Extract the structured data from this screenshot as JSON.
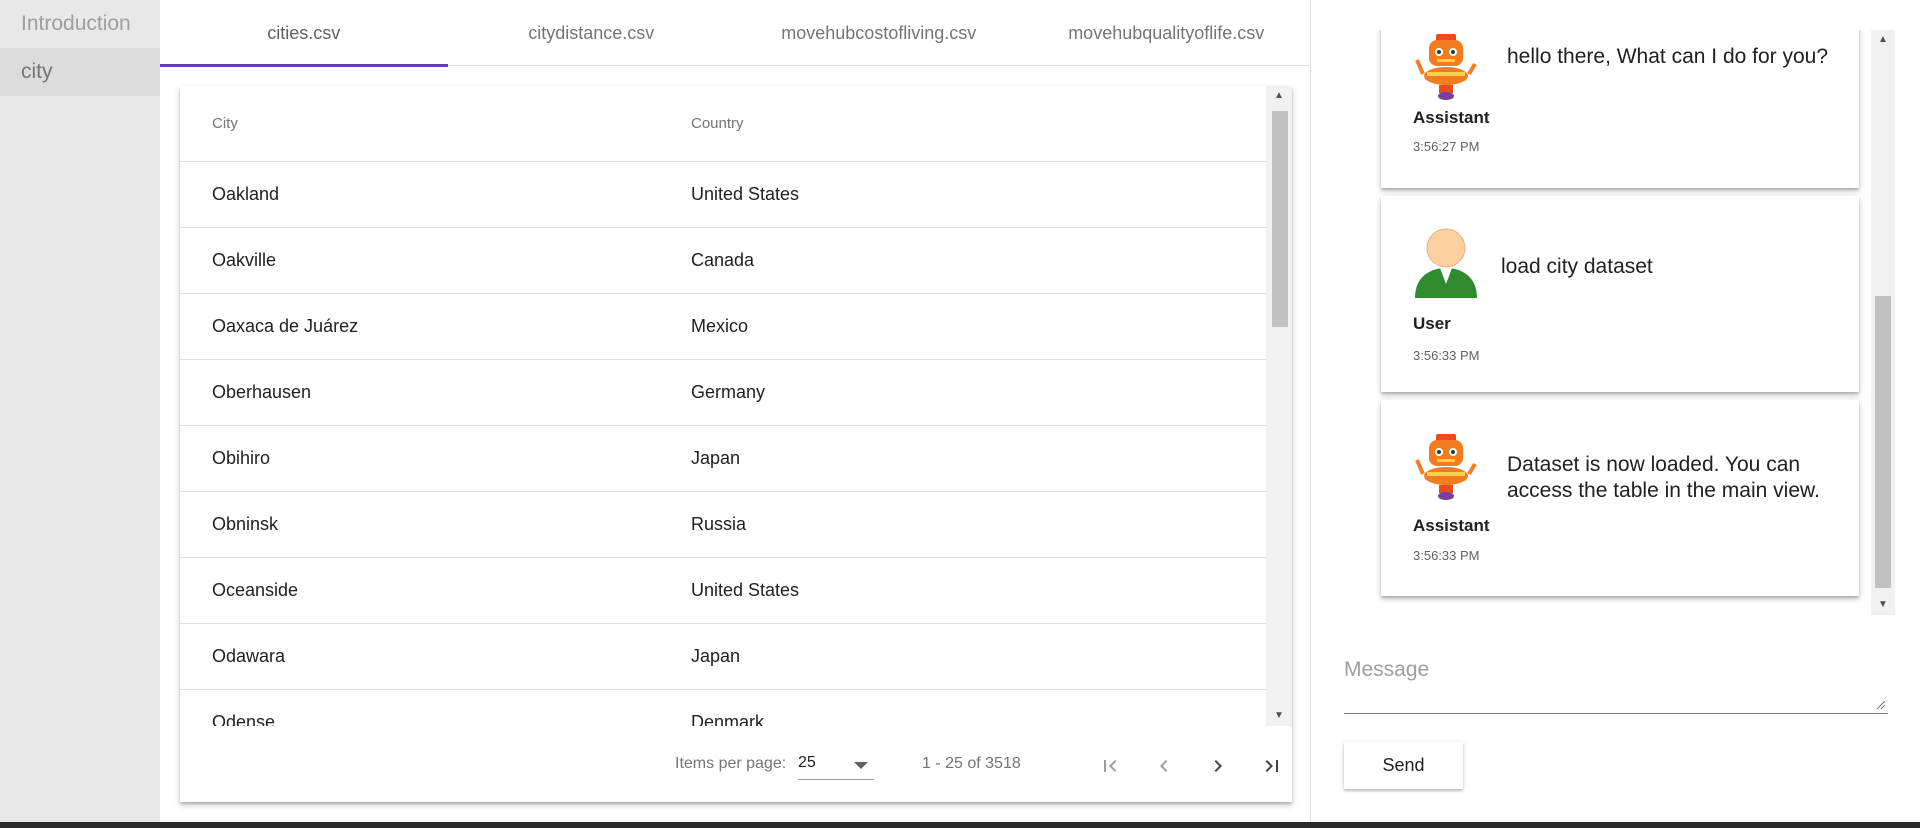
{
  "sidebar": {
    "items": [
      {
        "label": "Introduction"
      },
      {
        "label": "city"
      }
    ]
  },
  "tabs": [
    {
      "label": "cities.csv"
    },
    {
      "label": "citydistance.csv"
    },
    {
      "label": "movehubcostofliving.csv"
    },
    {
      "label": "movehubqualityoflife.csv"
    }
  ],
  "table": {
    "headers": {
      "city": "City",
      "country": "Country"
    },
    "rows": [
      {
        "city": "Oakland",
        "country": "United States"
      },
      {
        "city": "Oakville",
        "country": "Canada"
      },
      {
        "city": "Oaxaca de Juárez",
        "country": "Mexico"
      },
      {
        "city": "Oberhausen",
        "country": "Germany"
      },
      {
        "city": "Obihiro",
        "country": "Japan"
      },
      {
        "city": "Obninsk",
        "country": "Russia"
      },
      {
        "city": "Oceanside",
        "country": "United States"
      },
      {
        "city": "Odawara",
        "country": "Japan"
      },
      {
        "city": "Odense",
        "country": "Denmark"
      }
    ]
  },
  "paginator": {
    "label": "Items per page:",
    "page_size": "25",
    "range": "1 - 25 of 3518"
  },
  "chat": {
    "messages": [
      {
        "sender": "Assistant",
        "time": "3:56:27 PM",
        "text": "hello there, What can I do for you?",
        "avatar": "robot-avatar-icon"
      },
      {
        "sender": "User",
        "time": "3:56:33 PM",
        "text": "load city dataset",
        "avatar": "user-avatar-icon"
      },
      {
        "sender": "Assistant",
        "time": "3:56:33 PM",
        "text": "Dataset is now loaded. You can access the table in the main view.",
        "avatar": "robot-avatar-icon"
      }
    ],
    "input_placeholder": "Message",
    "send_label": "Send"
  },
  "colors": {
    "tab_accent": "#673ab7",
    "sidebar_bg": "#e8e8e8"
  }
}
